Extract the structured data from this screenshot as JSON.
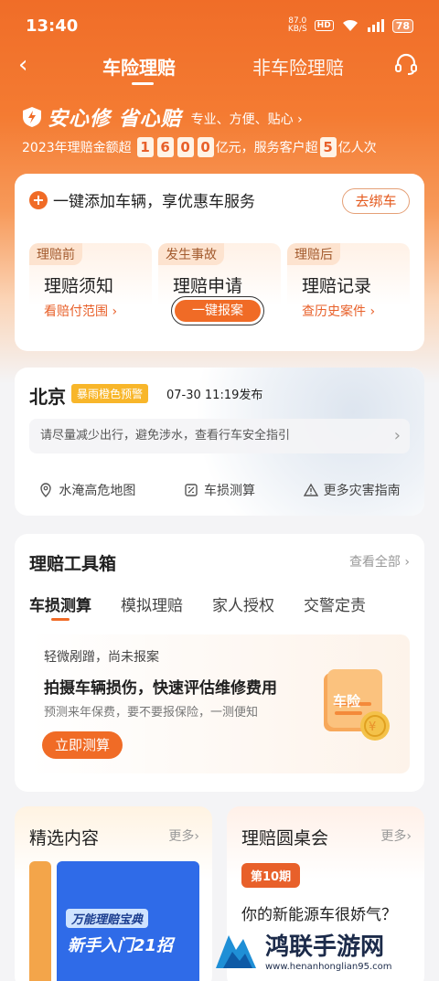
{
  "status_bar": {
    "time": "13:40",
    "net_speed": "87.0",
    "net_unit": "KB/S",
    "hd": "HD",
    "battery": "78"
  },
  "nav": {
    "tab_active": "车险理赔",
    "tab_other": "非车险理赔"
  },
  "slogan": {
    "title": "安心修 省心赔",
    "subtitle": "专业、方便、贴心 ›"
  },
  "stats": {
    "prefix": "2023年理赔金额超",
    "digits": [
      "1",
      "6",
      "0",
      "0"
    ],
    "mid": "亿元，服务客户超",
    "customer_digit": "5",
    "suffix": "亿人次"
  },
  "add_car": {
    "label": "一键添加车辆，享优惠车服务",
    "bind_button": "去绑车"
  },
  "steps": [
    {
      "tag": "理赔前",
      "name": "理赔须知",
      "link": "看赔付范围 ›"
    },
    {
      "tag": "发生事故",
      "name": "理赔申请",
      "action": "一键报案"
    },
    {
      "tag": "理赔后",
      "name": "理赔记录",
      "link": "查历史案件 ›"
    }
  ],
  "weather": {
    "city": "北京",
    "warning": "暴雨橙色预警",
    "time": "07-30 11:19发布",
    "advice": "请尽量减少出行，避免涉水，查看行车安全指引",
    "links": [
      "水淹高危地图",
      "车损测算",
      "更多灾害指南"
    ]
  },
  "toolbox": {
    "title": "理赔工具箱",
    "view_all": "查看全部 ›",
    "tabs": [
      "车损测算",
      "模拟理赔",
      "家人授权",
      "交警定责"
    ],
    "card": {
      "line1": "轻微剐蹭，尚未报案",
      "line2": "拍摄车辆损伤，快速评估维修费用",
      "line3": "预测来年保费，要不要报保险，一测便知",
      "button": "立即测算",
      "illustration_text": "车险"
    }
  },
  "featured": {
    "title": "精选内容",
    "more": "更多›",
    "thumb_tag": "万能理赔宝典",
    "thumb_title": "新手入门21招"
  },
  "roundtable": {
    "title": "理赔圆桌会",
    "more": "更多›",
    "issue": "第10期",
    "question": "你的新能源车很娇气？"
  },
  "watermark": {
    "title": "鸿联手游网",
    "url": "www.henanhonglian95.com"
  },
  "colors": {
    "accent": "#f06b26",
    "warning": "#f8b62a"
  }
}
